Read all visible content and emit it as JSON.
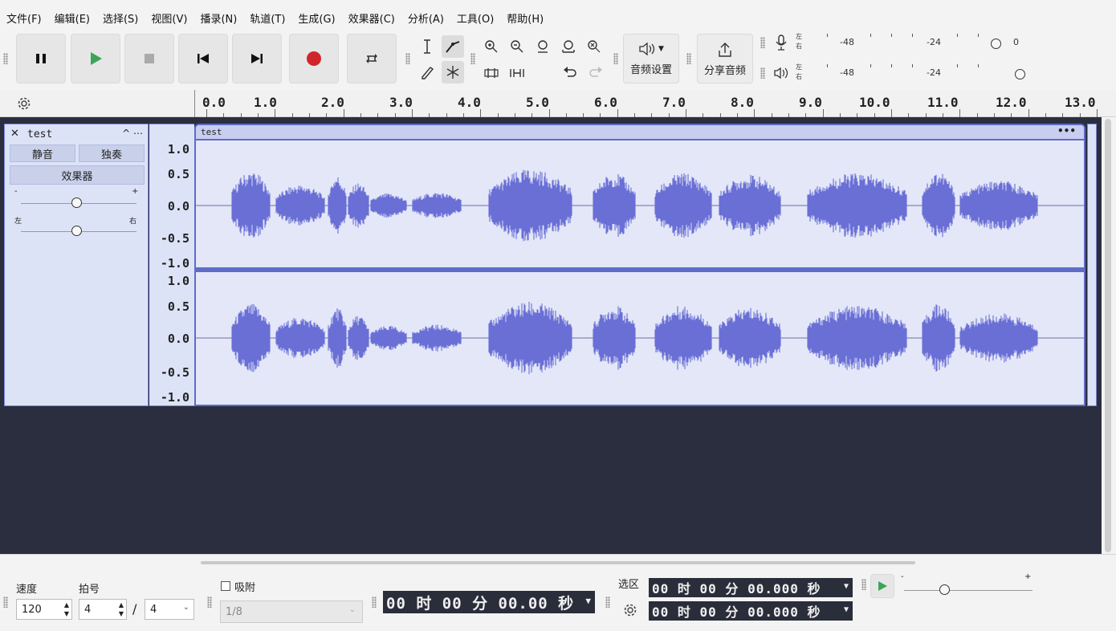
{
  "menu": [
    "文件(F)",
    "编辑(E)",
    "选择(S)",
    "视图(V)",
    "播录(N)",
    "轨道(T)",
    "生成(G)",
    "效果器(C)",
    "分析(A)",
    "工具(O)",
    "帮助(H)"
  ],
  "toolbar": {
    "audio_settings_label": "音频设置",
    "share_audio_label": "分享音频",
    "meter_rec": {
      "left": "左",
      "right": "右",
      "scale": [
        "-48",
        "-24",
        "0"
      ]
    },
    "meter_play": {
      "left": "左",
      "right": "右",
      "scale": [
        "-48",
        "-24"
      ]
    }
  },
  "ruler": {
    "ticks": [
      "0.0",
      "1.0",
      "2.0",
      "3.0",
      "4.0",
      "5.0",
      "6.0",
      "7.0",
      "8.0",
      "9.0",
      "10.0",
      "11.0",
      "12.0",
      "13.0"
    ]
  },
  "track": {
    "name": "test",
    "close_symbol": "✕",
    "menu_symbol": "^ ⋯",
    "mute_label": "静音",
    "solo_label": "独奏",
    "effects_label": "效果器",
    "gain_minus": "-",
    "gain_plus": "+",
    "pan_left": "左",
    "pan_right": "右",
    "clip_name": "test",
    "clip_menu": "•••",
    "channel_scale": [
      "1.0",
      "0.5",
      "0.0",
      "-0.5",
      "-1.0"
    ],
    "waveform_color": "#6a6fd6"
  },
  "bottom": {
    "tempo_label": "速度",
    "tempo_value": "120",
    "beats_label": "拍号",
    "beats_upper": "4",
    "beats_slash": "/",
    "beats_lower": "4",
    "snap_label": "吸附",
    "snap_value": "1/8",
    "time_display": "00 时 00 分 00.00 秒",
    "selection_label": "选区",
    "sel_start": "00 时 00 分 00.000 秒",
    "sel_end": "00 时 00 分 00.000 秒",
    "speed_minus": "-",
    "speed_plus": "+"
  }
}
